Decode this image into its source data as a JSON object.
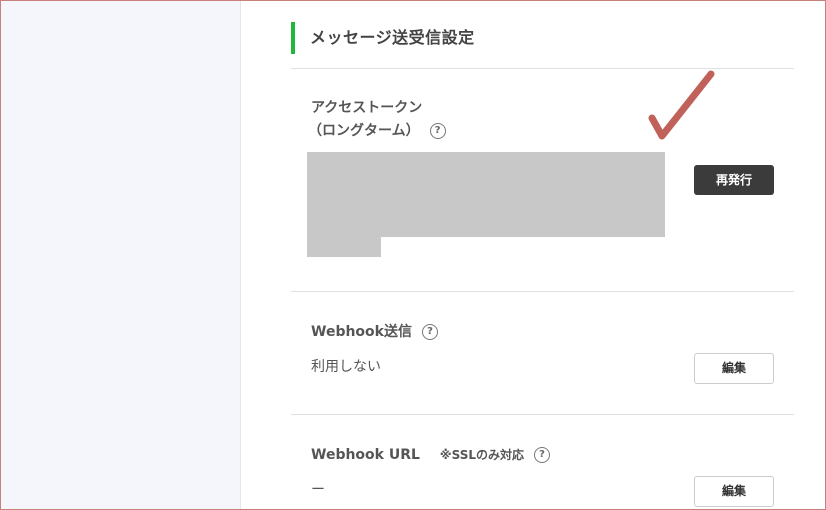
{
  "section": {
    "title": "メッセージ送受信設定"
  },
  "access_token": {
    "label_line1": "アクセストークン",
    "label_line2": "（ロングターム）",
    "help": "?",
    "reissue_button": "再発行"
  },
  "webhook_send": {
    "label": "Webhook送信",
    "help": "?",
    "value": "利用しない",
    "edit_button": "編集"
  },
  "webhook_url": {
    "label": "Webhook URL",
    "note": "※SSLのみ対応",
    "help": "?",
    "value": "ー",
    "edit_button": "編集"
  },
  "colors": {
    "accent": "#1fb83b",
    "dark_button": "#3b3b3b",
    "annotation": "#c0615a",
    "redaction": "#c8c8c8"
  }
}
